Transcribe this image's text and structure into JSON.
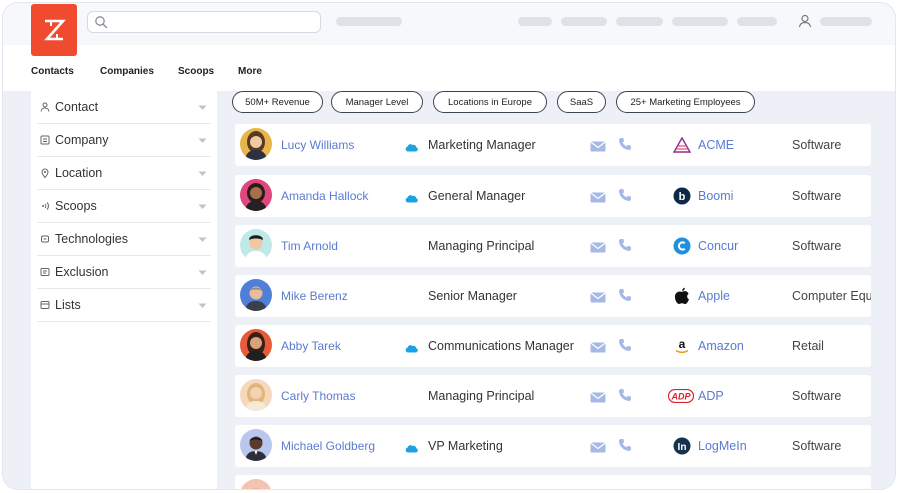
{
  "brand": {
    "logo_icon": "zoominfo-z-logo",
    "color": "#f04b2f"
  },
  "nav": {
    "items": [
      {
        "label": "Contacts"
      },
      {
        "label": "Companies"
      },
      {
        "label": "Scoops"
      },
      {
        "label": "More"
      }
    ]
  },
  "sidebar": {
    "items": [
      {
        "label": "Contact",
        "icon": "person-icon"
      },
      {
        "label": "Company",
        "icon": "building-icon"
      },
      {
        "label": "Location",
        "icon": "location-pin-icon"
      },
      {
        "label": "Scoops",
        "icon": "broadcast-icon"
      },
      {
        "label": "Technologies",
        "icon": "chip-icon"
      },
      {
        "label": "Exclusion",
        "icon": "exclusion-icon"
      },
      {
        "label": "Lists",
        "icon": "list-icon"
      }
    ]
  },
  "filters": [
    {
      "label": "50M+ Revenue"
    },
    {
      "label": "Manager Level"
    },
    {
      "label": "Locations in Europe"
    },
    {
      "label": "SaaS"
    },
    {
      "label": "25+ Marketing Employees"
    }
  ],
  "contacts": [
    {
      "name": "Lucy Williams",
      "title": "Marketing Manager",
      "salesforce": true,
      "company": "ACME",
      "company_icon": "acme-logo",
      "industry": "Software"
    },
    {
      "name": "Amanda Hallock",
      "title": "General Manager",
      "salesforce": true,
      "company": "Boomi",
      "company_icon": "boomi-logo",
      "industry": "Software"
    },
    {
      "name": "Tim Arnold",
      "title": "Managing Principal",
      "salesforce": false,
      "company": "Concur",
      "company_icon": "concur-logo",
      "industry": "Software"
    },
    {
      "name": "Mike Berenz",
      "title": "Senior Manager",
      "salesforce": false,
      "company": "Apple",
      "company_icon": "apple-logo",
      "industry": "Computer Equ"
    },
    {
      "name": "Abby Tarek",
      "title": "Communications Manager",
      "salesforce": true,
      "company": "Amazon",
      "company_icon": "amazon-logo",
      "industry": "Retail"
    },
    {
      "name": "Carly Thomas",
      "title": "Managing Principal",
      "salesforce": false,
      "company": "ADP",
      "company_icon": "adp-logo",
      "industry": "Software"
    },
    {
      "name": "Michael Goldberg",
      "title": "VP Marketing",
      "salesforce": true,
      "company": "LogMeIn",
      "company_icon": "logmein-logo",
      "industry": "Software"
    }
  ],
  "colors": {
    "link": "#5a7bd1",
    "salesforce": "#1ea1e0",
    "accent": "#f04b2f"
  }
}
